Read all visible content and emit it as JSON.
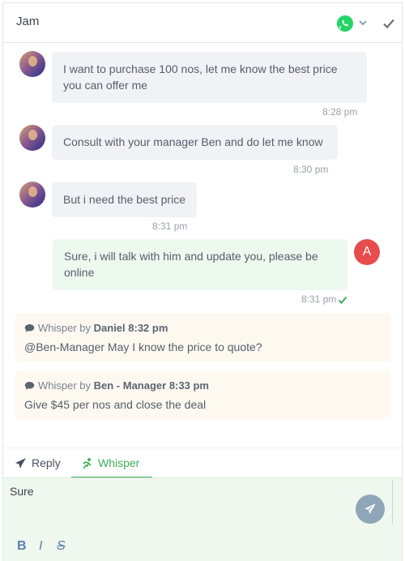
{
  "header": {
    "contact_name": "Jam"
  },
  "messages": [
    {
      "direction": "in",
      "lines": [
        "I want to purchase 100 nos, let me know the best price",
        "you can offer me"
      ],
      "time": "8:28 pm"
    },
    {
      "direction": "in",
      "lines": [
        "Consult with your manager Ben and do let me know"
      ],
      "time": "8:30 pm"
    },
    {
      "direction": "in",
      "lines": [
        "But i need the best price"
      ],
      "time": "8:31 pm"
    },
    {
      "direction": "out",
      "lines": [
        "Sure, i will talk with him and update you, please be",
        "online"
      ],
      "time": "8:31 pm",
      "agent_initial": "A"
    }
  ],
  "whispers": [
    {
      "prefix": "Whisper by ",
      "author_time": "Daniel 8:32 pm",
      "text": "@Ben-Manager May I know the price to quote?"
    },
    {
      "prefix": "Whisper by ",
      "author_time": "Ben - Manager 8:33 pm",
      "text": "Give $45 per nos and close the deal"
    }
  ],
  "tabs": {
    "reply": "Reply",
    "whisper": "Whisper",
    "active": "whisper"
  },
  "composer": {
    "value": "Sure"
  },
  "format": {
    "bold": "B",
    "italic": "I",
    "strike": "S"
  },
  "colors": {
    "accent_green": "#3fae5a",
    "whatsapp_green": "#25d366",
    "agent_avatar": "#e74c4c",
    "send_button": "#8fa6b8"
  },
  "icons": {
    "channel": "whatsapp-icon",
    "resolve": "check-icon",
    "reply": "paper-plane-icon",
    "whisper": "whisper-person-icon",
    "send": "send-icon",
    "comment": "comment-icon"
  }
}
